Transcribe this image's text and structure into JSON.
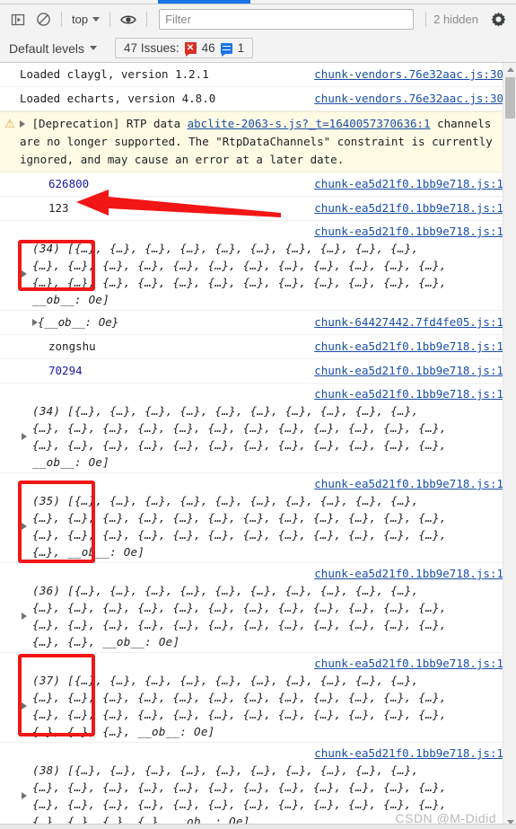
{
  "toolbar": {
    "sidebar_toggle_icon": "sidebar-panel-icon",
    "clear_console_icon": "clear-console-icon",
    "context_selector": "top",
    "eye_icon": "live-expression-eye-icon",
    "filter_placeholder": "Filter",
    "filter_value": "",
    "hidden_label": "2 hidden",
    "settings_icon": "gear-icon"
  },
  "levelbar": {
    "levels_label": "Default levels",
    "issues_label": "47 Issues:",
    "error_count": "46",
    "info_count": "1"
  },
  "messages": [
    {
      "kind": "log",
      "text": "Loaded claygl, version 1.2.1",
      "source": "chunk-vendors.76e32aac.js:30"
    },
    {
      "kind": "log",
      "text": "Loaded echarts, version 4.8.0",
      "source": "chunk-vendors.76e32aac.js:30"
    },
    {
      "kind": "warning",
      "prefix": "[Deprecation] RTP data ",
      "link": "abclite-2063-s.js?_t=1640057370636:1",
      "rest": "channels are no longer supported. The \"RtpDataChannels\" constraint is currently ignored, and may cause an error at a later date."
    },
    {
      "kind": "value-number",
      "text": "626800",
      "source": "chunk-ea5d21f0.1bb9e718.js:1"
    },
    {
      "kind": "value-string",
      "text": "123",
      "source": "chunk-ea5d21f0.1bb9e718.js:1"
    },
    {
      "kind": "array",
      "count": "(34)",
      "lines": [
        "[{…}, {…}, {…}, {…}, {…}, {…}, {…}, {…}, {…}, {…},",
        "{…}, {…}, {…}, {…}, {…}, {…}, {…}, {…}, {…}, {…}, {…}, {…},",
        "{…}, {…}, {…}, {…}, {…}, {…}, {…}, {…}, {…}, {…}, {…}, {…},",
        "__ob__: Oe]"
      ],
      "source": "chunk-ea5d21f0.1bb9e718.js:1"
    },
    {
      "kind": "object",
      "text": "{__ob__: Oe}",
      "source": "chunk-64427442.7fd4fe05.js:1"
    },
    {
      "kind": "value-string",
      "text": "zongshu",
      "source": "chunk-ea5d21f0.1bb9e718.js:1"
    },
    {
      "kind": "value-number",
      "text": "70294",
      "source": "chunk-ea5d21f0.1bb9e718.js:1"
    },
    {
      "kind": "array",
      "count": "(34)",
      "lines": [
        "[{…}, {…}, {…}, {…}, {…}, {…}, {…}, {…}, {…}, {…},",
        "{…}, {…}, {…}, {…}, {…}, {…}, {…}, {…}, {…}, {…}, {…}, {…},",
        "{…}, {…}, {…}, {…}, {…}, {…}, {…}, {…}, {…}, {…}, {…}, {…},",
        "__ob__: Oe]"
      ],
      "source": "chunk-ea5d21f0.1bb9e718.js:1"
    },
    {
      "kind": "array",
      "count": "(35)",
      "lines": [
        "[{…}, {…}, {…}, {…}, {…}, {…}, {…}, {…}, {…}, {…},",
        "{…}, {…}, {…}, {…}, {…}, {…}, {…}, {…}, {…}, {…}, {…}, {…},",
        "{…}, {…}, {…}, {…}, {…}, {…}, {…}, {…}, {…}, {…}, {…}, {…},",
        "{…}, __ob__: Oe]"
      ],
      "source": "chunk-ea5d21f0.1bb9e718.js:1"
    },
    {
      "kind": "array",
      "count": "(36)",
      "lines": [
        "[{…}, {…}, {…}, {…}, {…}, {…}, {…}, {…}, {…}, {…},",
        "{…}, {…}, {…}, {…}, {…}, {…}, {…}, {…}, {…}, {…}, {…}, {…},",
        "{…}, {…}, {…}, {…}, {…}, {…}, {…}, {…}, {…}, {…}, {…}, {…},",
        "{…}, {…}, __ob__: Oe]"
      ],
      "source": "chunk-ea5d21f0.1bb9e718.js:1"
    },
    {
      "kind": "array",
      "count": "(37)",
      "lines": [
        "[{…}, {…}, {…}, {…}, {…}, {…}, {…}, {…}, {…}, {…},",
        "{…}, {…}, {…}, {…}, {…}, {…}, {…}, {…}, {…}, {…}, {…}, {…},",
        "{…}, {…}, {…}, {…}, {…}, {…}, {…}, {…}, {…}, {…}, {…}, {…},",
        "{…}, {…}, {…}, __ob__: Oe]"
      ],
      "source": "chunk-ea5d21f0.1bb9e718.js:1"
    },
    {
      "kind": "array",
      "count": "(38)",
      "lines": [
        "[{…}, {…}, {…}, {…}, {…}, {…}, {…}, {…}, {…}, {…},",
        "{…}, {…}, {…}, {…}, {…}, {…}, {…}, {…}, {…}, {…}, {…}, {…},",
        "{…}, {…}, {…}, {…}, {…}, {…}, {…}, {…}, {…}, {…}, {…}, {…},",
        "{…}, {…}, {…}, {…}, __ob__: Oe]"
      ],
      "source": "chunk-ea5d21f0.1bb9e718.js:1"
    }
  ],
  "annotations": {
    "color": "#f21616",
    "arrow_name": "red-annotation-arrow",
    "boxes": [
      "array-34-highlight",
      "array-35-highlight",
      "array-37-highlight"
    ]
  },
  "watermark": "CSDN @M-Didid"
}
